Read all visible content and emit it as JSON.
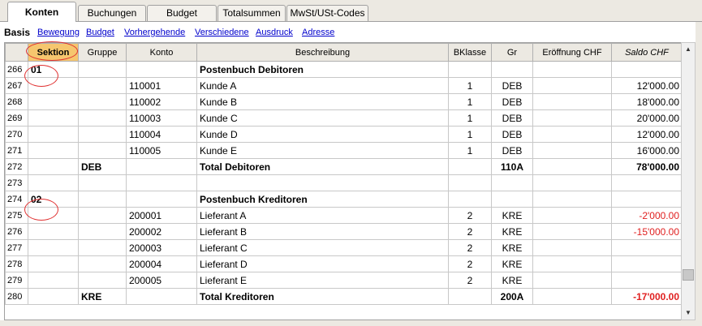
{
  "tabs": [
    {
      "label": "Konten",
      "active": true
    },
    {
      "label": "Buchungen"
    },
    {
      "label": "Budget"
    },
    {
      "label": "Totalsummen"
    },
    {
      "label": "MwSt/USt-Codes"
    }
  ],
  "views": [
    {
      "label": "Basis",
      "active": true
    },
    {
      "label": "Bewegung"
    },
    {
      "label": "Budget"
    },
    {
      "label": "Vorhergehende"
    },
    {
      "label": "Verschiedene"
    },
    {
      "label": "Ausdruck"
    },
    {
      "label": "Adresse"
    }
  ],
  "columns": [
    "",
    "Sektion",
    "Gruppe",
    "Konto",
    "Beschreibung",
    "BKlasse",
    "Gr",
    "Eröffnung CHF",
    "Saldo CHF"
  ],
  "rows": [
    {
      "n": "266",
      "sektion": "01",
      "gruppe": "",
      "konto": "",
      "beschreibung": "Postenbuch Debitoren",
      "bklasse": "",
      "gr": "",
      "eroeffnung": "",
      "saldo": "",
      "bold": true
    },
    {
      "n": "267",
      "sektion": "",
      "gruppe": "",
      "konto": "110001",
      "beschreibung": "Kunde A",
      "bklasse": "1",
      "gr": "DEB",
      "eroeffnung": "",
      "saldo": "12'000.00"
    },
    {
      "n": "268",
      "sektion": "",
      "gruppe": "",
      "konto": "110002",
      "beschreibung": "Kunde B",
      "bklasse": "1",
      "gr": "DEB",
      "eroeffnung": "",
      "saldo": "18'000.00"
    },
    {
      "n": "269",
      "sektion": "",
      "gruppe": "",
      "konto": "110003",
      "beschreibung": "Kunde C",
      "bklasse": "1",
      "gr": "DEB",
      "eroeffnung": "",
      "saldo": "20'000.00"
    },
    {
      "n": "270",
      "sektion": "",
      "gruppe": "",
      "konto": "110004",
      "beschreibung": "Kunde D",
      "bklasse": "1",
      "gr": "DEB",
      "eroeffnung": "",
      "saldo": "12'000.00"
    },
    {
      "n": "271",
      "sektion": "",
      "gruppe": "",
      "konto": "110005",
      "beschreibung": "Kunde E",
      "bklasse": "1",
      "gr": "DEB",
      "eroeffnung": "",
      "saldo": "16'000.00"
    },
    {
      "n": "272",
      "sektion": "",
      "gruppe": "DEB",
      "konto": "",
      "beschreibung": "Total Debitoren",
      "bklasse": "",
      "gr": "110A",
      "eroeffnung": "",
      "saldo": "78'000.00",
      "bold": true
    },
    {
      "n": "273",
      "sektion": "",
      "gruppe": "",
      "konto": "",
      "beschreibung": "",
      "bklasse": "",
      "gr": "",
      "eroeffnung": "",
      "saldo": ""
    },
    {
      "n": "274",
      "sektion": "02",
      "gruppe": "",
      "konto": "",
      "beschreibung": "Postenbuch Kreditoren",
      "bklasse": "",
      "gr": "",
      "eroeffnung": "",
      "saldo": "",
      "bold": true
    },
    {
      "n": "275",
      "sektion": "",
      "gruppe": "",
      "konto": "200001",
      "beschreibung": "Lieferant A",
      "bklasse": "2",
      "gr": "KRE",
      "eroeffnung": "",
      "saldo": "-2'000.00",
      "neg": true
    },
    {
      "n": "276",
      "sektion": "",
      "gruppe": "",
      "konto": "200002",
      "beschreibung": "Lieferant B",
      "bklasse": "2",
      "gr": "KRE",
      "eroeffnung": "",
      "saldo": "-15'000.00",
      "neg": true
    },
    {
      "n": "277",
      "sektion": "",
      "gruppe": "",
      "konto": "200003",
      "beschreibung": "Lieferant C",
      "bklasse": "2",
      "gr": "KRE",
      "eroeffnung": "",
      "saldo": ""
    },
    {
      "n": "278",
      "sektion": "",
      "gruppe": "",
      "konto": "200004",
      "beschreibung": "Lieferant D",
      "bklasse": "2",
      "gr": "KRE",
      "eroeffnung": "",
      "saldo": ""
    },
    {
      "n": "279",
      "sektion": "",
      "gruppe": "",
      "konto": "200005",
      "beschreibung": "Lieferant E",
      "bklasse": "2",
      "gr": "KRE",
      "eroeffnung": "",
      "saldo": ""
    },
    {
      "n": "280",
      "sektion": "",
      "gruppe": "KRE",
      "konto": "",
      "beschreibung": "Total Kreditoren",
      "bklasse": "",
      "gr": "200A",
      "eroeffnung": "",
      "saldo": "-17'000.00",
      "bold": true,
      "neg": true
    }
  ],
  "icons": {
    "scroll_up": "arrow-up-icon",
    "scroll_down": "arrow-down-icon"
  },
  "colors": {
    "selected_header": "#f6c66e",
    "negative": "#e02020",
    "link": "#0000cc",
    "annotation": "#e03030"
  }
}
